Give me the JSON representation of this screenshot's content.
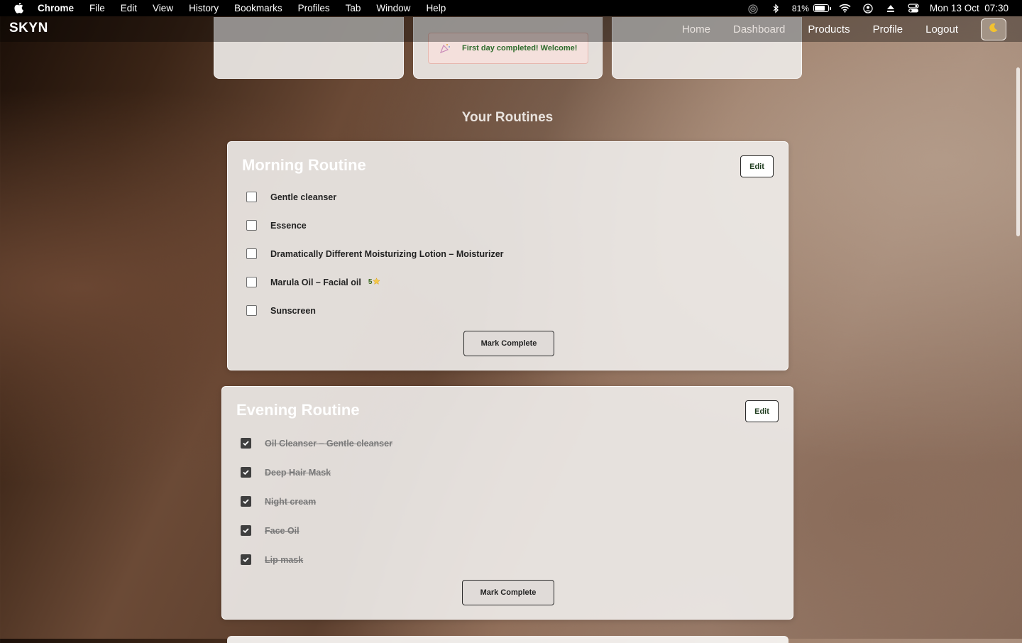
{
  "menubar": {
    "items": [
      "Chrome",
      "File",
      "Edit",
      "View",
      "History",
      "Bookmarks",
      "Profiles",
      "Tab",
      "Window",
      "Help"
    ],
    "battery_percent": "81%",
    "battery_level": 0.81,
    "datetime": "Mon 13 Oct  07:30",
    "icons": [
      "apple-icon",
      "airdrop-icon",
      "bluetooth-icon",
      "battery-icon",
      "wifi-icon",
      "user-icon",
      "eject-icon",
      "control-center-icon"
    ]
  },
  "nav": {
    "brand": "SKYN",
    "links": [
      "Home",
      "Dashboard",
      "Products",
      "Profile",
      "Logout"
    ],
    "theme_icon": "moon-icon"
  },
  "notice": {
    "text": "First day completed! Welcome!",
    "icon": "celebration-icon"
  },
  "section_title": "Your Routines",
  "morning": {
    "title": "Morning Routine",
    "edit_label": "Edit",
    "steps": [
      {
        "label": "Gentle cleanser",
        "checked": false
      },
      {
        "label": "Essence",
        "checked": false
      },
      {
        "label": "Dramatically Different Moisturizing Lotion – Moisturizer",
        "checked": false
      },
      {
        "label": "Marula Oil – Facial oil",
        "checked": false,
        "rating": "5",
        "rating_icon": "star-icon"
      },
      {
        "label": "Sunscreen",
        "checked": false
      }
    ],
    "complete_label": "Mark Complete"
  },
  "evening": {
    "title": "Evening Routine",
    "edit_label": "Edit",
    "steps": [
      {
        "label": "Oil Cleanser – Gentle cleanser",
        "checked": true
      },
      {
        "label": "Deep Hair Mask",
        "checked": true
      },
      {
        "label": "Night cream",
        "checked": true
      },
      {
        "label": "Face Oil",
        "checked": true
      },
      {
        "label": "Lip mask",
        "checked": true
      }
    ],
    "complete_label": "Mark Complete"
  },
  "colors": {
    "menubar_bg": "#000000",
    "card_bg": "#f0edeb",
    "notice_text": "#2d6b2b",
    "notice_bg": "#f4e0dc"
  }
}
